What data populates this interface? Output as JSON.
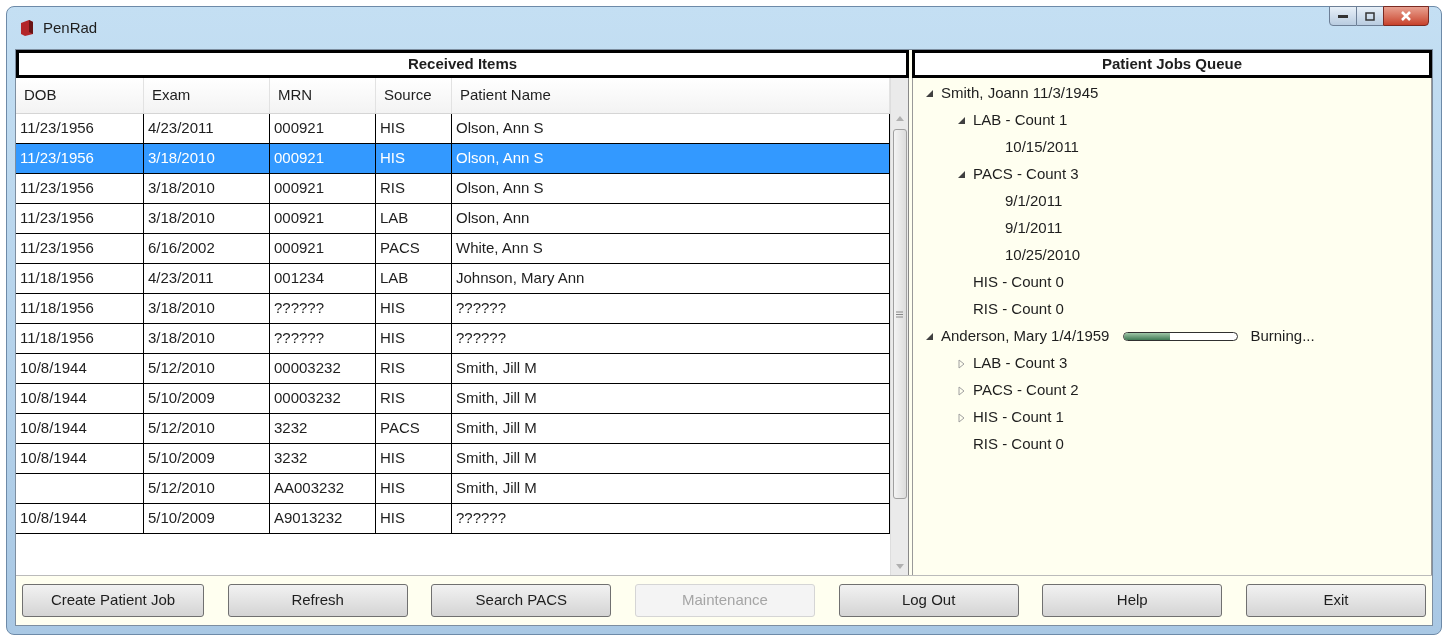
{
  "window": {
    "title": "PenRad"
  },
  "received_items": {
    "title": "Received Items",
    "columns": [
      "DOB",
      "Exam",
      "MRN",
      "Source",
      "Patient Name"
    ],
    "rows": [
      {
        "cells": [
          "11/23/1956",
          "4/23/2011",
          "000921",
          "HIS",
          "Olson, Ann S"
        ],
        "selected": false
      },
      {
        "cells": [
          "11/23/1956",
          "3/18/2010",
          "000921",
          "HIS",
          "Olson, Ann S"
        ],
        "selected": true
      },
      {
        "cells": [
          "11/23/1956",
          "3/18/2010",
          "000921",
          "RIS",
          "Olson, Ann S"
        ],
        "selected": false
      },
      {
        "cells": [
          "11/23/1956",
          "3/18/2010",
          "000921",
          "LAB",
          "Olson, Ann"
        ],
        "selected": false
      },
      {
        "cells": [
          "11/23/1956",
          "6/16/2002",
          "000921",
          "PACS",
          "White, Ann S"
        ],
        "selected": false
      },
      {
        "cells": [
          "11/18/1956",
          "4/23/2011",
          "001234",
          "LAB",
          "Johnson, Mary Ann"
        ],
        "selected": false
      },
      {
        "cells": [
          "11/18/1956",
          "3/18/2010",
          "??????",
          "HIS",
          "??????"
        ],
        "selected": false
      },
      {
        "cells": [
          "11/18/1956",
          "3/18/2010",
          "??????",
          "HIS",
          "??????"
        ],
        "selected": false
      },
      {
        "cells": [
          "10/8/1944",
          "5/12/2010",
          "00003232",
          "RIS",
          "Smith, Jill M"
        ],
        "selected": false
      },
      {
        "cells": [
          "10/8/1944",
          "5/10/2009",
          "00003232",
          "RIS",
          "Smith, Jill M"
        ],
        "selected": false
      },
      {
        "cells": [
          "10/8/1944",
          "5/12/2010",
          "3232",
          "PACS",
          "Smith, Jill M"
        ],
        "selected": false
      },
      {
        "cells": [
          "10/8/1944",
          "5/10/2009",
          "3232",
          "HIS",
          "Smith, Jill M"
        ],
        "selected": false
      },
      {
        "cells": [
          "",
          "5/12/2010",
          "AA003232",
          "HIS",
          "Smith, Jill M"
        ],
        "selected": false
      },
      {
        "cells": [
          "10/8/1944",
          "5/10/2009",
          "A9013232",
          "HIS",
          "??????"
        ],
        "selected": false
      }
    ]
  },
  "patient_jobs_queue": {
    "title": "Patient Jobs Queue",
    "tree": [
      {
        "label": "Smith, Joann 11/3/1945",
        "expanded": true,
        "children": [
          {
            "label": "LAB - Count 1",
            "expanded": true,
            "children": [
              {
                "label": "10/15/2011"
              }
            ]
          },
          {
            "label": "PACS - Count 3",
            "expanded": true,
            "children": [
              {
                "label": "9/1/2011"
              },
              {
                "label": "9/1/2011"
              },
              {
                "label": "10/25/2010"
              }
            ]
          },
          {
            "label": "HIS - Count 0"
          },
          {
            "label": "RIS - Count 0"
          }
        ]
      },
      {
        "label": "Anderson, Mary 1/4/1959",
        "expanded": true,
        "progress": {
          "level": 0.4,
          "status": "Burning..."
        },
        "children": [
          {
            "label": "LAB - Count 3",
            "expanded": false
          },
          {
            "label": "PACS - Count 2",
            "expanded": false
          },
          {
            "label": "HIS - Count 1",
            "expanded": false
          },
          {
            "label": "RIS - Count 0"
          }
        ]
      }
    ]
  },
  "buttons": [
    {
      "label": "Create Patient Job",
      "disabled": false
    },
    {
      "label": "Refresh",
      "disabled": false
    },
    {
      "label": "Search PACS",
      "disabled": false
    },
    {
      "label": "Maintenance",
      "disabled": true
    },
    {
      "label": "Log Out",
      "disabled": false
    },
    {
      "label": "Help",
      "disabled": false
    },
    {
      "label": "Exit",
      "disabled": false
    }
  ]
}
